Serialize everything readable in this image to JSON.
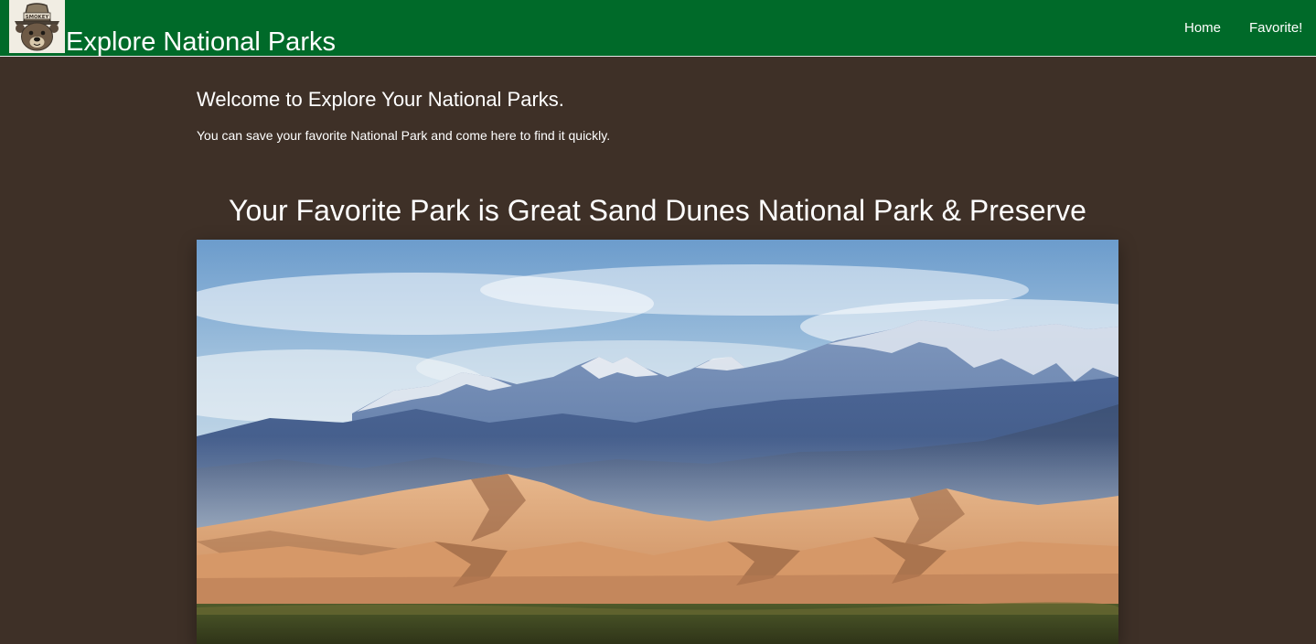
{
  "header": {
    "logo_icon": "smokey-bear-logo-icon",
    "logo_badge_text": "SMOKEY",
    "title": "Explore National Parks",
    "nav": [
      {
        "label": "Home"
      },
      {
        "label": "Favorite!"
      }
    ]
  },
  "welcome": {
    "title": "Welcome to Explore Your National Parks.",
    "text": "You can save your favorite National Park and come here to find it quickly."
  },
  "favorite": {
    "heading": "Your Favorite Park is Great Sand Dunes National Park & Preserve",
    "image_subject": "great-sand-dunes-landscape"
  },
  "colors": {
    "nav_background": "#006a29",
    "page_background": "#3e3027",
    "text": "#ffffff"
  }
}
